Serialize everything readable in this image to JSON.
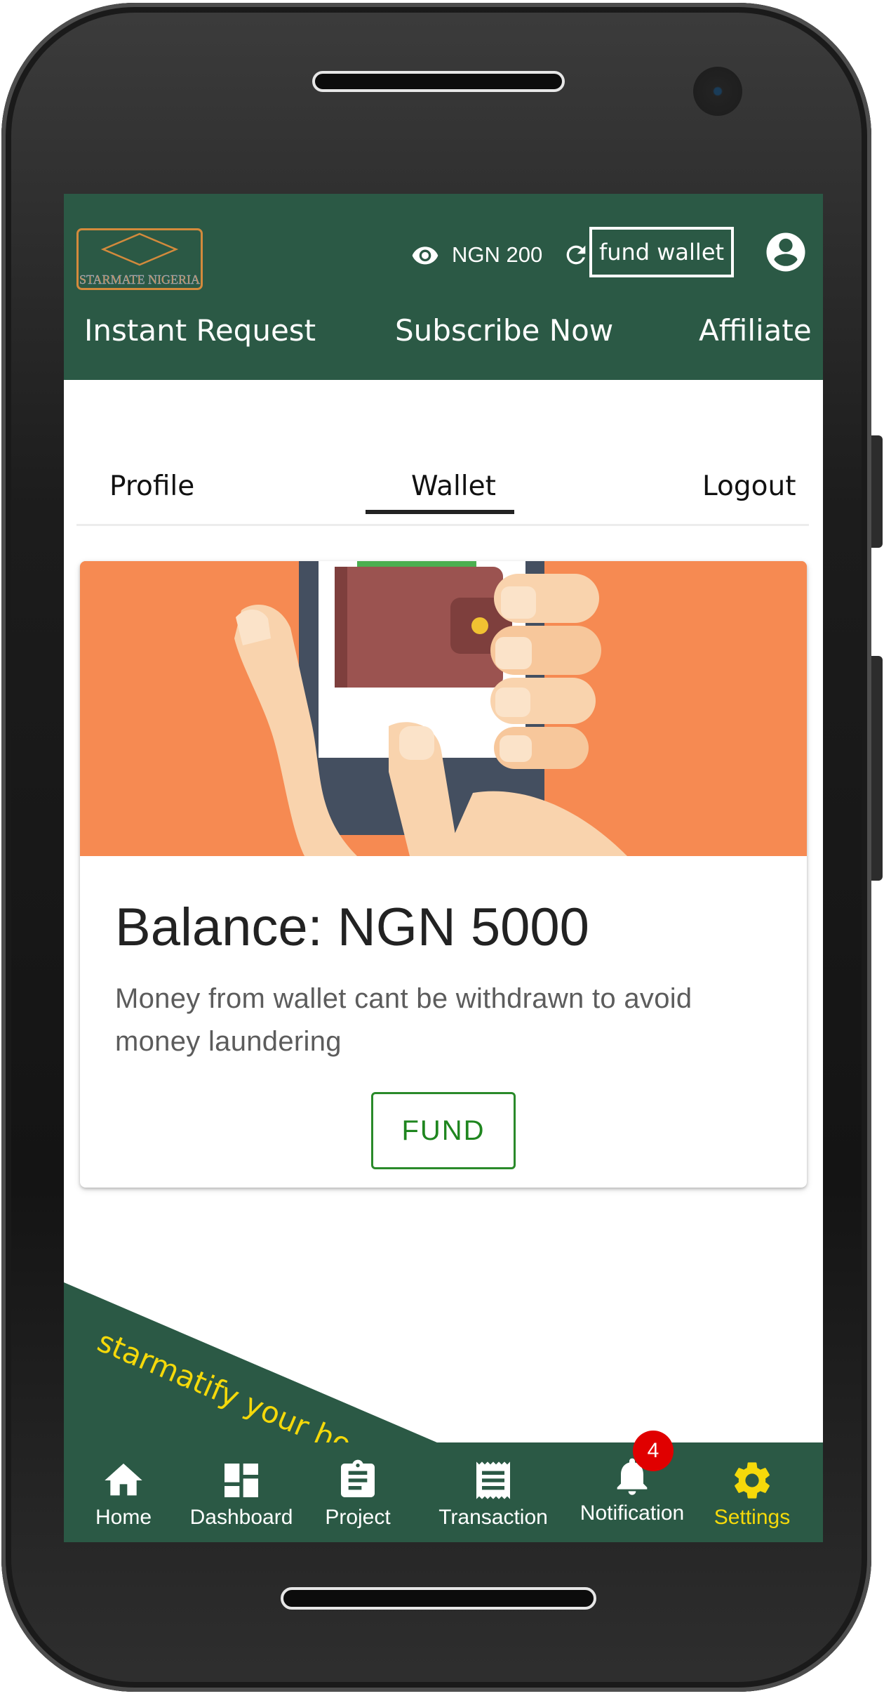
{
  "header": {
    "logo_text": "STARMATE NIGERIA",
    "balance_label": "NGN 200",
    "fund_wallet_label": "fund wallet",
    "nav_links": [
      "Instant Request",
      "Subscribe Now",
      "Affiliate"
    ]
  },
  "tabs": {
    "items": [
      "Profile",
      "Wallet",
      "Logout"
    ],
    "active": "Wallet"
  },
  "wallet_card": {
    "title": "Balance: NGN 5000",
    "text": "Money from wallet cant be withdrawn to avoid money laundering",
    "fund_button_label": "FUND"
  },
  "banner": {
    "text": "starmatify your ho"
  },
  "bottom_nav": {
    "items": [
      {
        "label": "Home",
        "icon": "home-icon"
      },
      {
        "label": "Dashboard",
        "icon": "dashboard-icon"
      },
      {
        "label": "Project",
        "icon": "clipboard-icon"
      },
      {
        "label": "Transaction",
        "icon": "receipt-icon"
      },
      {
        "label": "Notification",
        "icon": "bell-icon"
      },
      {
        "label": "Settings",
        "icon": "gear-icon"
      }
    ],
    "active": "Settings",
    "notification_count": "4"
  },
  "colors": {
    "header_green": "#2b5945",
    "accent_yellow": "#f5d90a",
    "card_media_orange": "#f68a52",
    "fund_green": "#1f861f",
    "badge_red": "#e00000"
  }
}
